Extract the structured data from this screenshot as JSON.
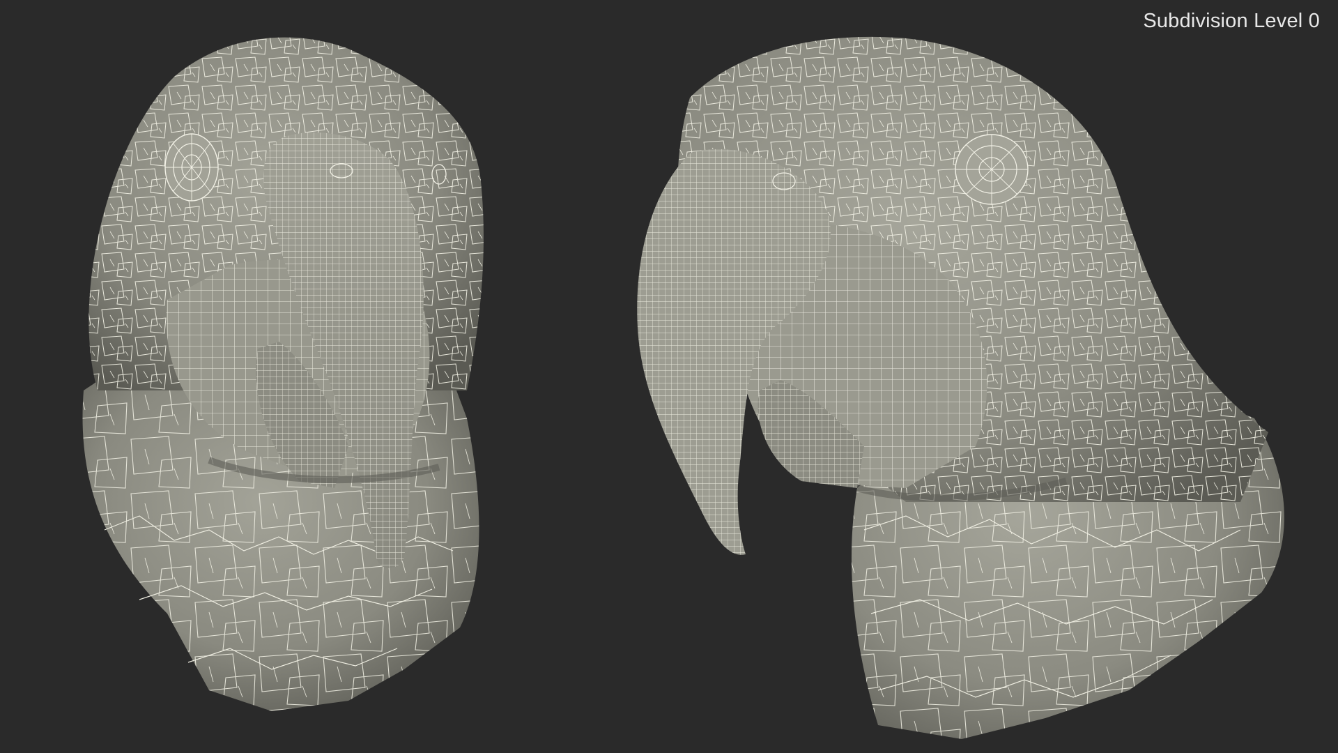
{
  "viewport": {
    "label": "Subdivision Level 0",
    "background": "#2a2a2a",
    "mesh_fill": "#8f8f84",
    "mesh_shadow": "#5f5f57",
    "wire_color": "#f2f1e6"
  },
  "models": [
    {
      "view": "front"
    },
    {
      "view": "side"
    }
  ]
}
